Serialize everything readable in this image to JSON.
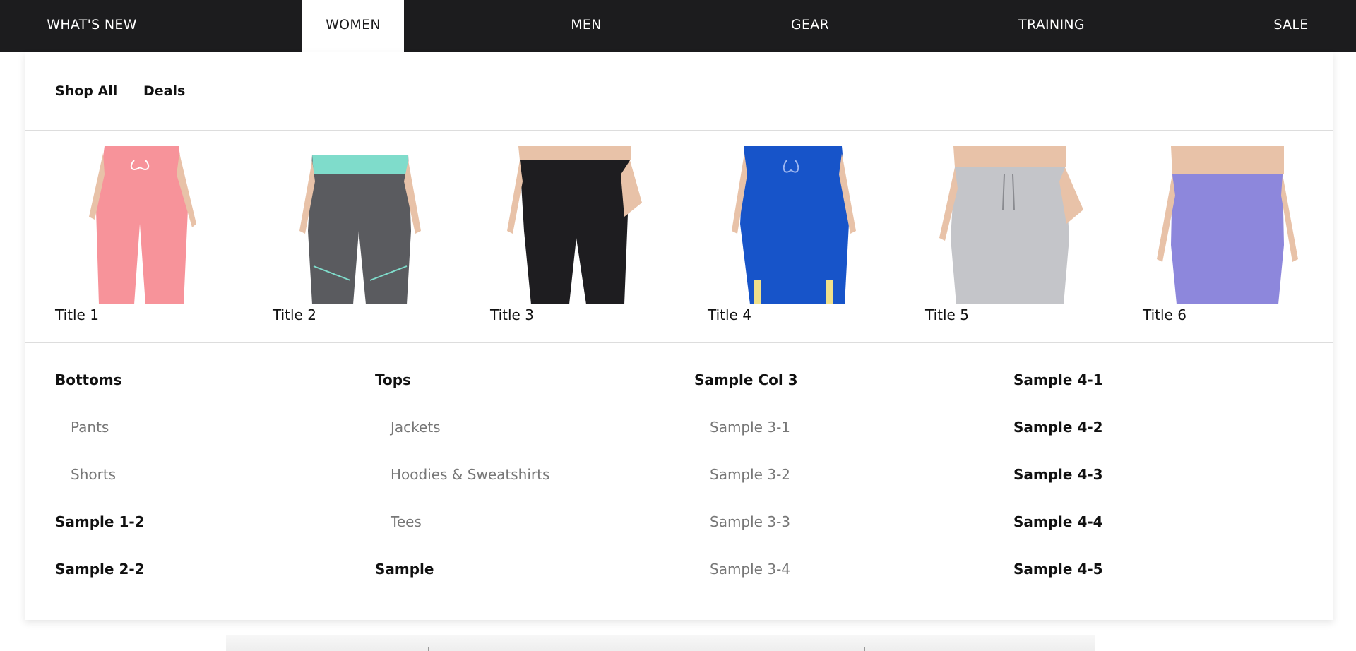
{
  "nav": {
    "items": [
      {
        "label": "WHAT'S NEW"
      },
      {
        "label": "WOMEN"
      },
      {
        "label": "MEN"
      },
      {
        "label": "GEAR"
      },
      {
        "label": "TRAINING"
      },
      {
        "label": "SALE"
      }
    ],
    "active": "WOMEN"
  },
  "quicklinks": [
    {
      "label": "Shop All"
    },
    {
      "label": "Deals"
    }
  ],
  "products": [
    {
      "title": "Title 1",
      "color": "#f7939a"
    },
    {
      "title": "Title 2",
      "color": "#5a5b5f",
      "accent": "#7fdccb"
    },
    {
      "title": "Title 3",
      "color": "#1e1d20"
    },
    {
      "title": "Title 4",
      "color": "#1754c9",
      "accent": "#f0e08a"
    },
    {
      "title": "Title 5",
      "color": "#c4c5c9"
    },
    {
      "title": "Title 6",
      "color": "#8d87dc"
    }
  ],
  "columns": [
    {
      "items": [
        {
          "label": "Bottoms",
          "style": "bold"
        },
        {
          "label": "Pants",
          "style": "sub"
        },
        {
          "label": "Shorts",
          "style": "sub"
        },
        {
          "label": "Sample 1-2",
          "style": "bold"
        },
        {
          "label": "Sample 2-2",
          "style": "bold"
        }
      ]
    },
    {
      "items": [
        {
          "label": "Tops",
          "style": "bold"
        },
        {
          "label": "Jackets",
          "style": "sub"
        },
        {
          "label": "Hoodies & Sweatshirts",
          "style": "sub"
        },
        {
          "label": "Tees",
          "style": "sub"
        },
        {
          "label": "Sample",
          "style": "bold"
        }
      ]
    },
    {
      "items": [
        {
          "label": "Sample Col 3",
          "style": "bold"
        },
        {
          "label": "Sample 3-1",
          "style": "sub"
        },
        {
          "label": "Sample 3-2",
          "style": "sub"
        },
        {
          "label": "Sample 3-3",
          "style": "sub"
        },
        {
          "label": "Sample 3-4",
          "style": "sub"
        }
      ]
    },
    {
      "items": [
        {
          "label": "Sample 4-1",
          "style": "bold"
        },
        {
          "label": "Sample 4-2",
          "style": "bold"
        },
        {
          "label": "Sample 4-3",
          "style": "bold"
        },
        {
          "label": "Sample 4-4",
          "style": "bold"
        },
        {
          "label": "Sample 4-5",
          "style": "bold"
        }
      ]
    }
  ]
}
